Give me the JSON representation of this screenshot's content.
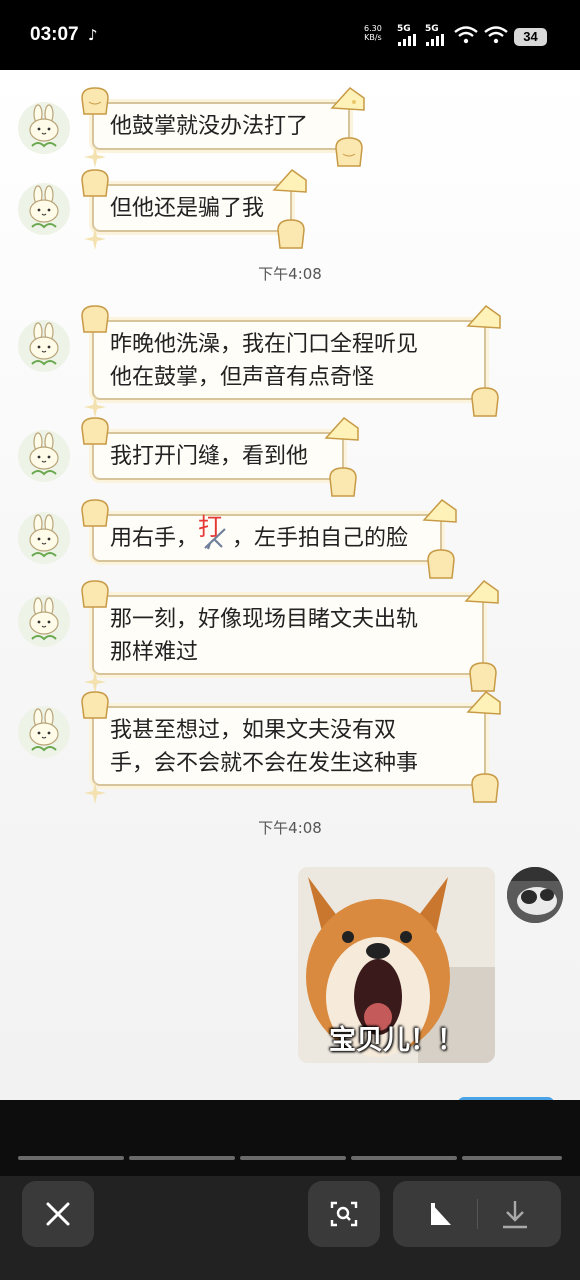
{
  "status_bar": {
    "time": "03:07",
    "net_speed_value": "6.30",
    "net_speed_unit": "KB/s",
    "sim1": "5G",
    "sim2": "5G",
    "battery": "34"
  },
  "messages": [
    {
      "text": "他鼓掌就没办法打了"
    },
    {
      "text": "但他还是骗了我"
    },
    {
      "text_line1": "昨晚他洗澡，我在门口全程听见",
      "text_line2": "他在鼓掌，但声音有点奇怪"
    },
    {
      "text": "我打开门缝，看到他"
    },
    {
      "text_before": "用右手，",
      "annotation": "打",
      "text_after": "，左手拍自己的脸"
    },
    {
      "text_line1": "那一刻，好像现场目睹文夫出轨",
      "text_line2": "那样难过"
    },
    {
      "text_line1": "我甚至想过，如果文夫没有双",
      "text_line2": "手，会不会就不会在发生这种事"
    }
  ],
  "timestamps": [
    "下午4:08",
    "下午4:08"
  ],
  "sticker": {
    "caption": "宝贝儿！！"
  },
  "colors": {
    "bubble_border": "#d8c49a",
    "annotation_red": "#e53935"
  },
  "toolbar": {
    "icons": [
      "close-icon",
      "scan-icon",
      "play-icon",
      "download-icon"
    ]
  }
}
